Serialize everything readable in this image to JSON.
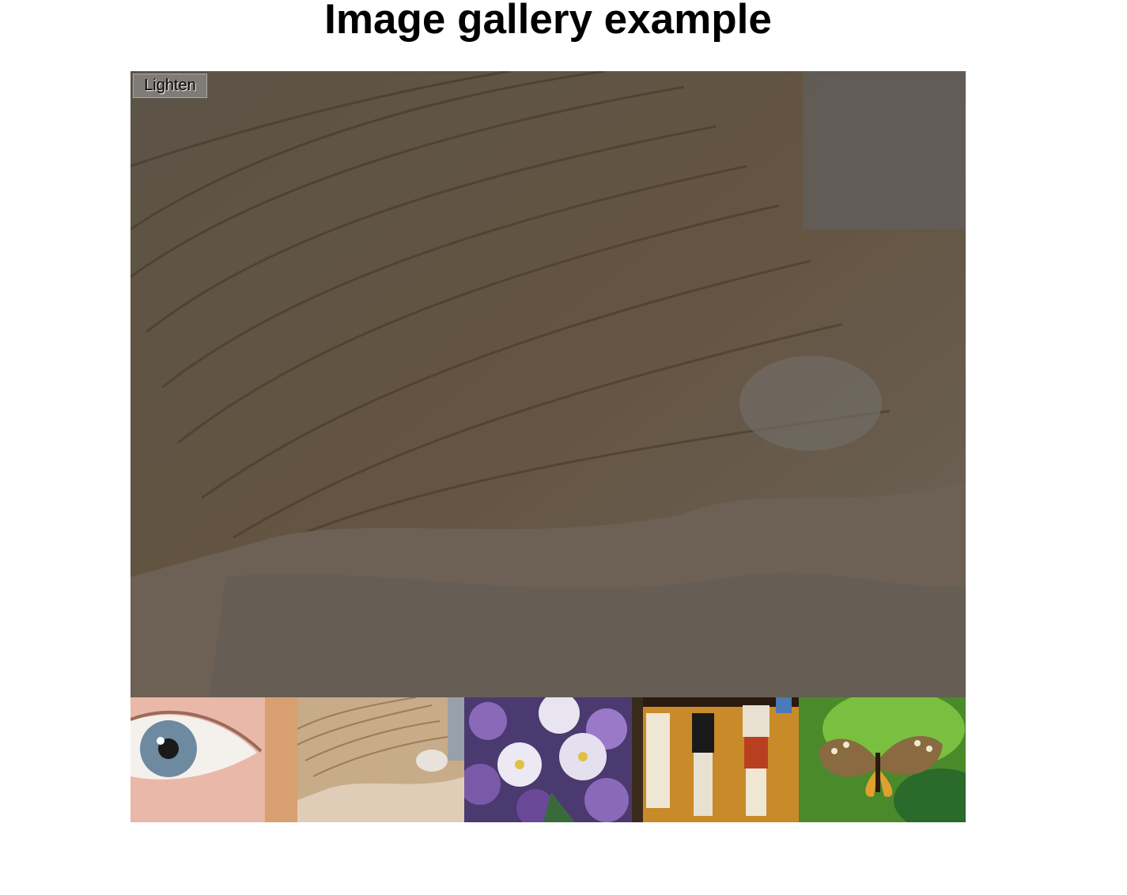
{
  "page": {
    "title": "Image gallery example"
  },
  "full_image": {
    "subject": "sandstone rock formation",
    "darkened": true
  },
  "toggle_button": {
    "label": "Lighten"
  },
  "thumbnails": [
    {
      "subject": "eye"
    },
    {
      "subject": "sandstone rock formation"
    },
    {
      "subject": "purple and white flowers"
    },
    {
      "subject": "egyptian wall painting"
    },
    {
      "subject": "butterfly on leaf"
    }
  ],
  "colors": {
    "background": "#ffffff",
    "overlay": "rgba(0,0,0,0.5)",
    "button_bg": "rgba(150,150,150,0.6)"
  }
}
